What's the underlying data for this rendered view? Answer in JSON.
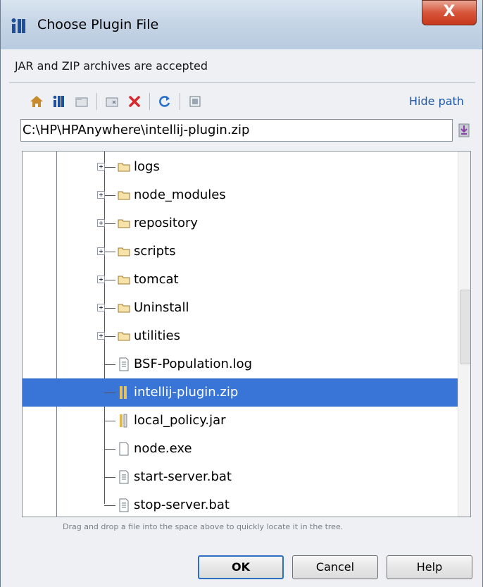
{
  "window": {
    "title": "Choose Plugin File",
    "close_label": "X"
  },
  "subtitle": "JAR and ZIP archives are accepted",
  "toolbar": {
    "icons": [
      "home-icon",
      "project-icon",
      "module-icon",
      "new-folder-icon",
      "delete-icon",
      "refresh-icon",
      "show-hidden-icon"
    ],
    "hide_path_label": "Hide path"
  },
  "path": {
    "value": "C:\\HP\\HPAnywhere\\intellij-plugin.zip"
  },
  "tree": {
    "items": [
      {
        "label": "logs",
        "type": "folder"
      },
      {
        "label": "node_modules",
        "type": "folder"
      },
      {
        "label": "repository",
        "type": "folder"
      },
      {
        "label": "scripts",
        "type": "folder"
      },
      {
        "label": "tomcat",
        "type": "folder"
      },
      {
        "label": "Uninstall",
        "type": "folder"
      },
      {
        "label": "utilities",
        "type": "folder"
      },
      {
        "label": "BSF-Population.log",
        "type": "text-file"
      },
      {
        "label": "intellij-plugin.zip",
        "type": "archive",
        "selected": true
      },
      {
        "label": "local_policy.jar",
        "type": "archive"
      },
      {
        "label": "node.exe",
        "type": "file"
      },
      {
        "label": "start-server.bat",
        "type": "text-file"
      },
      {
        "label": "stop-server.bat",
        "type": "text-file"
      }
    ]
  },
  "hint": "Drag and drop a file into the space above to quickly locate it in the tree.",
  "buttons": {
    "ok": "OK",
    "cancel": "Cancel",
    "help": "Help"
  },
  "colors": {
    "selection": "#3875d7",
    "link": "#1f57a8",
    "folder": "#e8c060"
  }
}
